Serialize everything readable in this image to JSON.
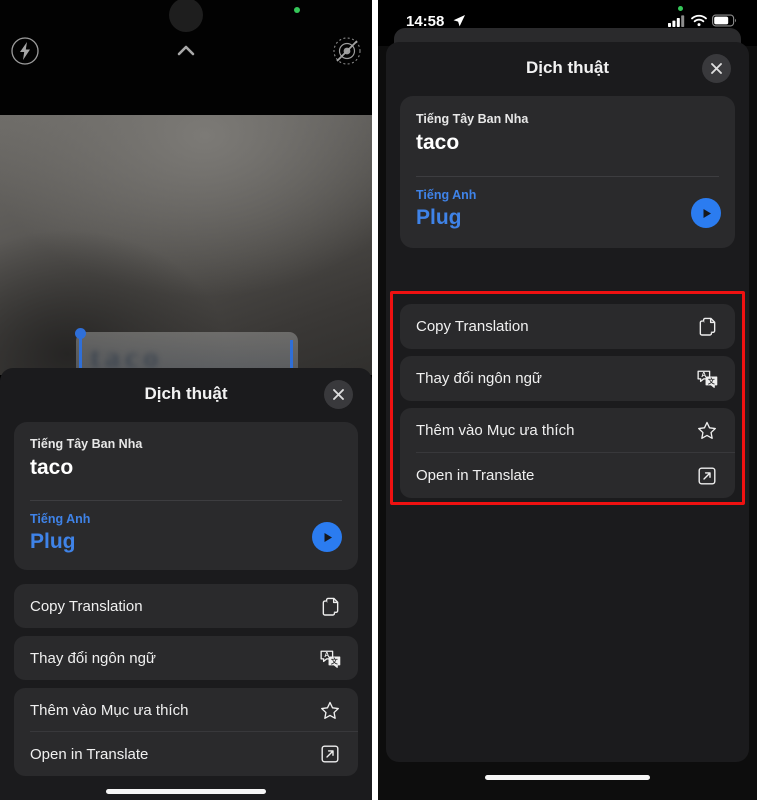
{
  "left_phone": {
    "camera": {
      "flash_icon": "flash-icon",
      "chevron_icon": "chevron-up-icon",
      "live_photo_icon": "live-photo-off-icon",
      "recording_indicator": "green-privacy-dot"
    },
    "selection_blur_text": "taco",
    "sheet": {
      "title": "Dịch thuật",
      "close_label": "✕",
      "card": {
        "source_language": "Tiếng Tây Ban Nha",
        "source_text": "taco",
        "target_language": "Tiếng Anh",
        "target_text": "Plug",
        "play_icon": "play-audio-icon"
      },
      "actions": [
        {
          "label": "Copy Translation",
          "icon": "copy-icon"
        },
        {
          "label": "Thay đổi ngôn ngữ",
          "icon": "translate-languages-icon"
        },
        {
          "label": "Thêm vào Mục ưa thích",
          "icon": "star-icon"
        },
        {
          "label": "Open in Translate",
          "icon": "external-link-icon"
        }
      ]
    }
  },
  "right_phone": {
    "statusbar": {
      "time": "14:58",
      "location_icon": "location-arrow-icon",
      "signal_icon": "cellular-signal-icon",
      "wifi_icon": "wifi-icon",
      "battery_icon": "battery-icon",
      "recording_indicator": "green-privacy-dot"
    },
    "sheet": {
      "title": "Dịch thuật",
      "close_label": "✕",
      "card": {
        "source_language": "Tiếng Tây Ban Nha",
        "source_text": "taco",
        "target_language": "Tiếng Anh",
        "target_text": "Plug",
        "play_icon": "play-audio-icon"
      },
      "actions": [
        {
          "label": "Copy Translation",
          "icon": "copy-icon"
        },
        {
          "label": "Thay đổi ngôn ngữ",
          "icon": "translate-languages-icon"
        },
        {
          "label": "Thêm vào Mục ưa thích",
          "icon": "star-icon"
        },
        {
          "label": "Open in Translate",
          "icon": "external-link-icon"
        }
      ]
    },
    "annotation": {
      "name": "red-highlight-box",
      "color": "#ef1111"
    }
  },
  "colors": {
    "accent_blue": "#2b7cf0",
    "link_blue": "#3f83e8",
    "sheet_bg": "#1b1b1d",
    "card_bg": "#2a2a2c",
    "highlight_red": "#ef1111"
  }
}
